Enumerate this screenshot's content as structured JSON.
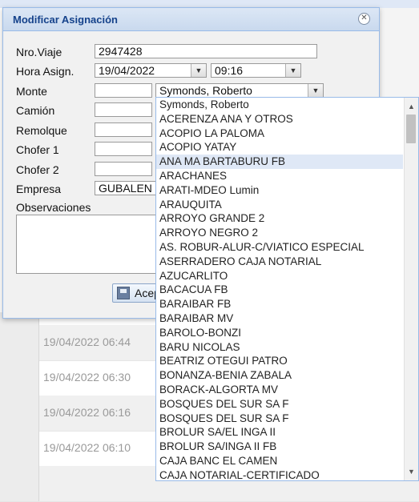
{
  "background": {
    "timestamps": [
      "19/04/2022 06:44",
      "19/04/2022 06:30",
      "19/04/2022 06:16",
      "19/04/2022 06:10"
    ]
  },
  "dialog": {
    "title": "Modificar Asignación",
    "labels": {
      "nro_viaje": "Nro.Viaje",
      "hora_asign": "Hora Asign.",
      "monte": "Monte",
      "camion": "Camión",
      "remolque": "Remolque",
      "chofer1": "Chofer 1",
      "chofer2": "Chofer 2",
      "empresa": "Empresa",
      "observaciones": "Observaciones"
    },
    "values": {
      "nro_viaje": "2947428",
      "fecha": "19/04/2022",
      "hora": "09:16",
      "monte": "Symonds, Roberto",
      "empresa": "GUBALEN S"
    },
    "accept_label": "Acep"
  },
  "dropdown": {
    "selected_index": 4,
    "options": [
      "Symonds, Roberto",
      "ACERENZA ANA Y OTROS",
      "ACOPIO LA PALOMA",
      "ACOPIO YATAY",
      "ANA MA BARTABURU FB",
      "ARACHANES",
      "ARATI-MDEO Lumin",
      "ARAUQUITA",
      "ARROYO GRANDE 2",
      "ARROYO NEGRO 2",
      "AS. ROBUR-ALUR-C/VIATICO ESPECIAL",
      "ASERRADERO CAJA NOTARIAL",
      "AZUCARLITO",
      "BACACUA FB",
      "BARAIBAR FB",
      "BARAIBAR MV",
      "BAROLO-BONZI",
      "BARU NICOLAS",
      "BEATRIZ OTEGUI PATRO",
      "BONANZA-BENIA ZABALA",
      "BORACK-ALGORTA MV",
      "BOSQUES DEL SUR SA F",
      "BOSQUES DEL SUR SA F",
      "BROLUR SA/EL INGA II",
      "BROLUR SA/INGA II FB",
      "CAJA BANC EL CAMEN",
      "CAJA NOTARIAL-CERTIFICADO"
    ]
  }
}
